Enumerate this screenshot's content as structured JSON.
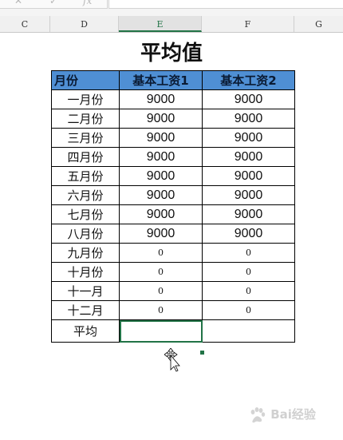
{
  "formula_bar": {
    "icons": [
      "close-icon",
      "check-icon",
      "function-icon"
    ],
    "fx_label": "fx",
    "value": ""
  },
  "columns": [
    {
      "label": "C",
      "selected": false
    },
    {
      "label": "D",
      "selected": false
    },
    {
      "label": "E",
      "selected": true
    },
    {
      "label": "F",
      "selected": false
    },
    {
      "label": "G",
      "selected": false
    }
  ],
  "sheet": {
    "title": "平均值",
    "headers": [
      "月份",
      "基本工资1",
      "基本工资2"
    ],
    "rows": [
      [
        "一月份",
        "9000",
        "9000"
      ],
      [
        "二月份",
        "9000",
        "9000"
      ],
      [
        "三月份",
        "9000",
        "9000"
      ],
      [
        "四月份",
        "9000",
        "9000"
      ],
      [
        "五月份",
        "9000",
        "9000"
      ],
      [
        "六月份",
        "9000",
        "9000"
      ],
      [
        "七月份",
        "9000",
        "9000"
      ],
      [
        "八月份",
        "9000",
        "9000"
      ],
      [
        "九月份",
        "0",
        "0"
      ],
      [
        "十月份",
        "0",
        "0"
      ],
      [
        "十一月",
        "0",
        "0"
      ],
      [
        "十二月",
        "0",
        "0"
      ]
    ],
    "footer": [
      "平均",
      "",
      ""
    ]
  },
  "colors": {
    "header_fill": "#4f8fd4",
    "selection": "#217346"
  },
  "watermark": {
    "text": "Bai经验"
  }
}
